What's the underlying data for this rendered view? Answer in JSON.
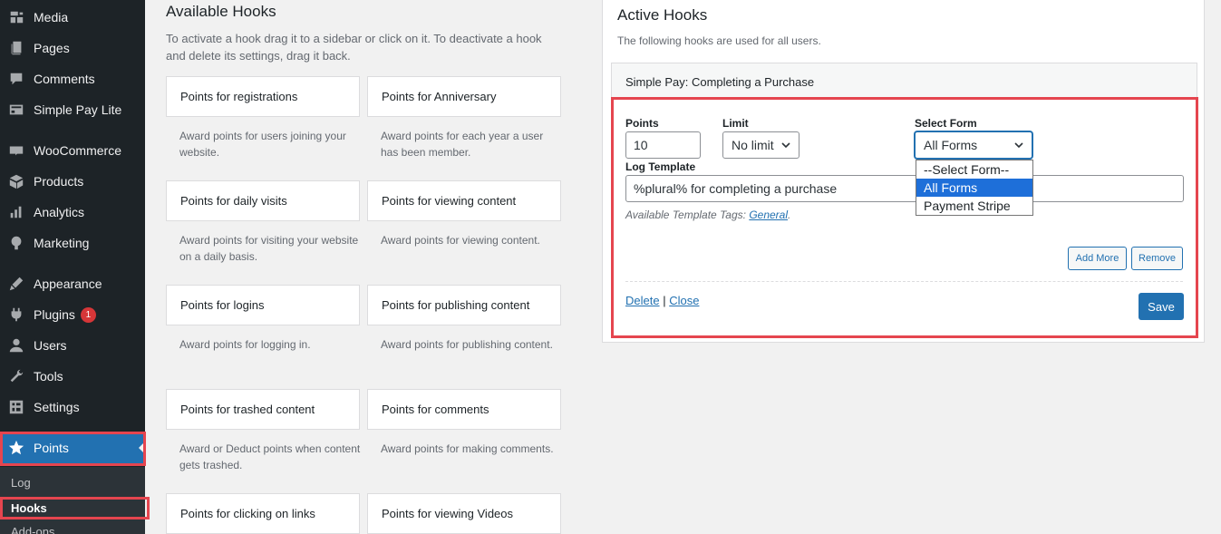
{
  "sidebar": {
    "items": [
      {
        "label": "Media",
        "icon": "media-icon"
      },
      {
        "label": "Pages",
        "icon": "pages-icon"
      },
      {
        "label": "Comments",
        "icon": "comments-icon"
      },
      {
        "label": "Simple Pay Lite",
        "icon": "simple-pay-icon"
      },
      {
        "label": "WooCommerce",
        "icon": "woocommerce-icon"
      },
      {
        "label": "Products",
        "icon": "products-icon"
      },
      {
        "label": "Analytics",
        "icon": "analytics-icon"
      },
      {
        "label": "Marketing",
        "icon": "marketing-icon"
      },
      {
        "label": "Appearance",
        "icon": "appearance-icon"
      },
      {
        "label": "Plugins",
        "icon": "plugins-icon",
        "badge": "1"
      },
      {
        "label": "Users",
        "icon": "users-icon"
      },
      {
        "label": "Tools",
        "icon": "tools-icon"
      },
      {
        "label": "Settings",
        "icon": "settings-icon"
      },
      {
        "label": "Points",
        "icon": "star-icon",
        "active": true
      }
    ],
    "submenu": [
      {
        "label": "Log"
      },
      {
        "label": "Hooks",
        "current": true
      },
      {
        "label": "Add-ons"
      }
    ]
  },
  "available": {
    "title": "Available Hooks",
    "description": "To activate a hook drag it to a sidebar or click on it. To deactivate a hook and delete its settings, drag it back.",
    "hooks": [
      {
        "title": "Points for registrations",
        "desc": "Award points for users joining your website."
      },
      {
        "title": "Points for Anniversary",
        "desc": "Award points for each year a user has been member."
      },
      {
        "title": "Points for daily visits",
        "desc": "Award points for visiting your website on a daily basis."
      },
      {
        "title": "Points for viewing content",
        "desc": "Award points for viewing content."
      },
      {
        "title": "Points for logins",
        "desc": "Award points for logging in."
      },
      {
        "title": "Points for publishing content",
        "desc": "Award points for publishing content."
      },
      {
        "title": "Points for trashed content",
        "desc": "Award or Deduct points when content gets trashed."
      },
      {
        "title": "Points for comments",
        "desc": "Award points for making comments."
      },
      {
        "title": "Points for clicking on links",
        "desc": ""
      },
      {
        "title": "Points for viewing Videos",
        "desc": ""
      }
    ]
  },
  "active": {
    "title": "Active Hooks",
    "description": "The following hooks are used for all users.",
    "hook_title": "Simple Pay: Completing a Purchase",
    "points_label": "Points",
    "points_value": "10",
    "limit_label": "Limit",
    "limit_value": "No limit",
    "select_form_label": "Select Form",
    "select_form_value": "All Forms",
    "select_form_options": [
      "--Select Form--",
      "All Forms",
      "Payment Stripe"
    ],
    "log_template_label": "Log Template",
    "log_template_value": "%plural% for completing a purchase",
    "tags_prefix": "Available Template Tags:",
    "tags_link": "General",
    "tags_suffix": ".",
    "add_more_label": "Add More",
    "remove_label": "Remove",
    "delete_label": "Delete",
    "separator": "|",
    "close_label": "Close",
    "save_label": "Save"
  },
  "colors": {
    "sidebar_bg": "#1d2327",
    "accent": "#2271b1",
    "highlight": "#e5454f",
    "badge": "#d63638"
  }
}
